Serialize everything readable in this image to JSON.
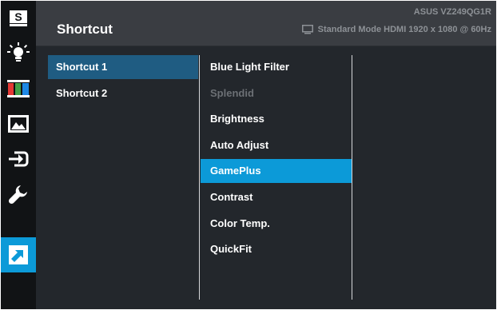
{
  "rail": {
    "items": [
      {
        "icon": "splendid-s-icon",
        "label": "S"
      },
      {
        "icon": "blue-light-icon"
      },
      {
        "icon": "color-bars-icon"
      },
      {
        "icon": "image-icon"
      },
      {
        "icon": "input-select-icon"
      },
      {
        "icon": "wrench-icon"
      },
      {
        "icon": "shortcut-arrow-icon"
      }
    ],
    "active_index": 6
  },
  "header": {
    "title": "Shortcut",
    "model": "ASUS VZ249QG1R",
    "status": "Standard Mode HDMI 1920 x 1080 @ 60Hz",
    "status_icon": "monitor-icon"
  },
  "shortcuts": {
    "items": [
      "Shortcut 1",
      "Shortcut 2"
    ],
    "selected": "Shortcut 1"
  },
  "functions": {
    "items": [
      {
        "label": "Blue Light Filter",
        "state": "normal"
      },
      {
        "label": "Splendid",
        "state": "disabled"
      },
      {
        "label": "Brightness",
        "state": "normal"
      },
      {
        "label": "Auto Adjust",
        "state": "normal"
      },
      {
        "label": "GamePlus",
        "state": "highlighted"
      },
      {
        "label": "Contrast",
        "state": "normal"
      },
      {
        "label": "Color Temp.",
        "state": "normal"
      },
      {
        "label": "QuickFit",
        "state": "normal"
      }
    ]
  },
  "colors": {
    "accent": "#0c9ad8",
    "selected_row": "#1f5c82",
    "background": "#23272c",
    "header": "#3a3d42"
  }
}
